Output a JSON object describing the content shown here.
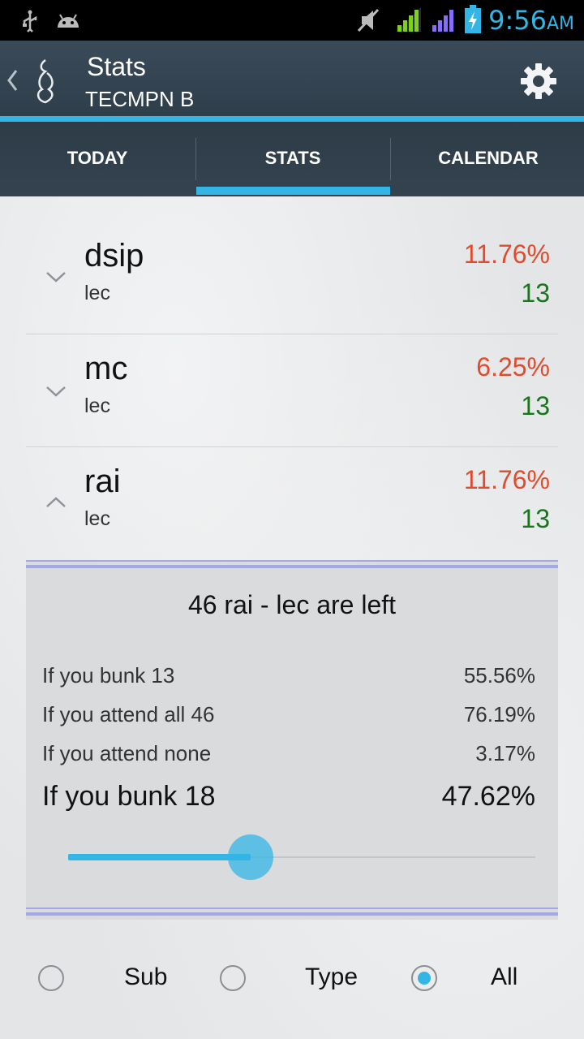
{
  "status_bar": {
    "time": "9:56",
    "ampm": "AM",
    "icons": [
      "usb-icon",
      "android-icon",
      "mute-icon",
      "signal-icon",
      "signal-2-icon",
      "battery-icon"
    ],
    "colors": {
      "accent": "#33b5e5",
      "signal": "#7bd21c",
      "signal2": "#8a6bff"
    }
  },
  "app_bar": {
    "title": "Stats",
    "subtitle": "TECMPN B"
  },
  "tabs": [
    {
      "label": "TODAY",
      "selected": false
    },
    {
      "label": "STATS",
      "selected": true
    },
    {
      "label": "CALENDAR",
      "selected": false
    }
  ],
  "subjects": [
    {
      "name": "dsip",
      "type": "lec",
      "percent": "11.76%",
      "count": "13",
      "expanded": false
    },
    {
      "name": "mc",
      "type": "lec",
      "percent": "6.25%",
      "count": "13",
      "expanded": false
    },
    {
      "name": "rai",
      "type": "lec",
      "percent": "11.76%",
      "count": "13",
      "expanded": true
    }
  ],
  "detail": {
    "title": "46 rai - lec are left",
    "rows": [
      {
        "label": "If you bunk 13",
        "value": "55.56%"
      },
      {
        "label": "If you attend all 46",
        "value": "76.19%"
      },
      {
        "label": "If you attend none",
        "value": "3.17%"
      }
    ],
    "highlight": {
      "label": "If you bunk 18",
      "value": "47.62%"
    },
    "slider_fraction": 0.39
  },
  "filter": {
    "options": [
      {
        "label": "Sub",
        "selected": false
      },
      {
        "label": "Type",
        "selected": false
      },
      {
        "label": "All",
        "selected": true
      }
    ]
  },
  "colors": {
    "percent": "#e14b2d",
    "count": "#17761a",
    "accent": "#33b5e5",
    "divider": "#a4a9e6"
  }
}
